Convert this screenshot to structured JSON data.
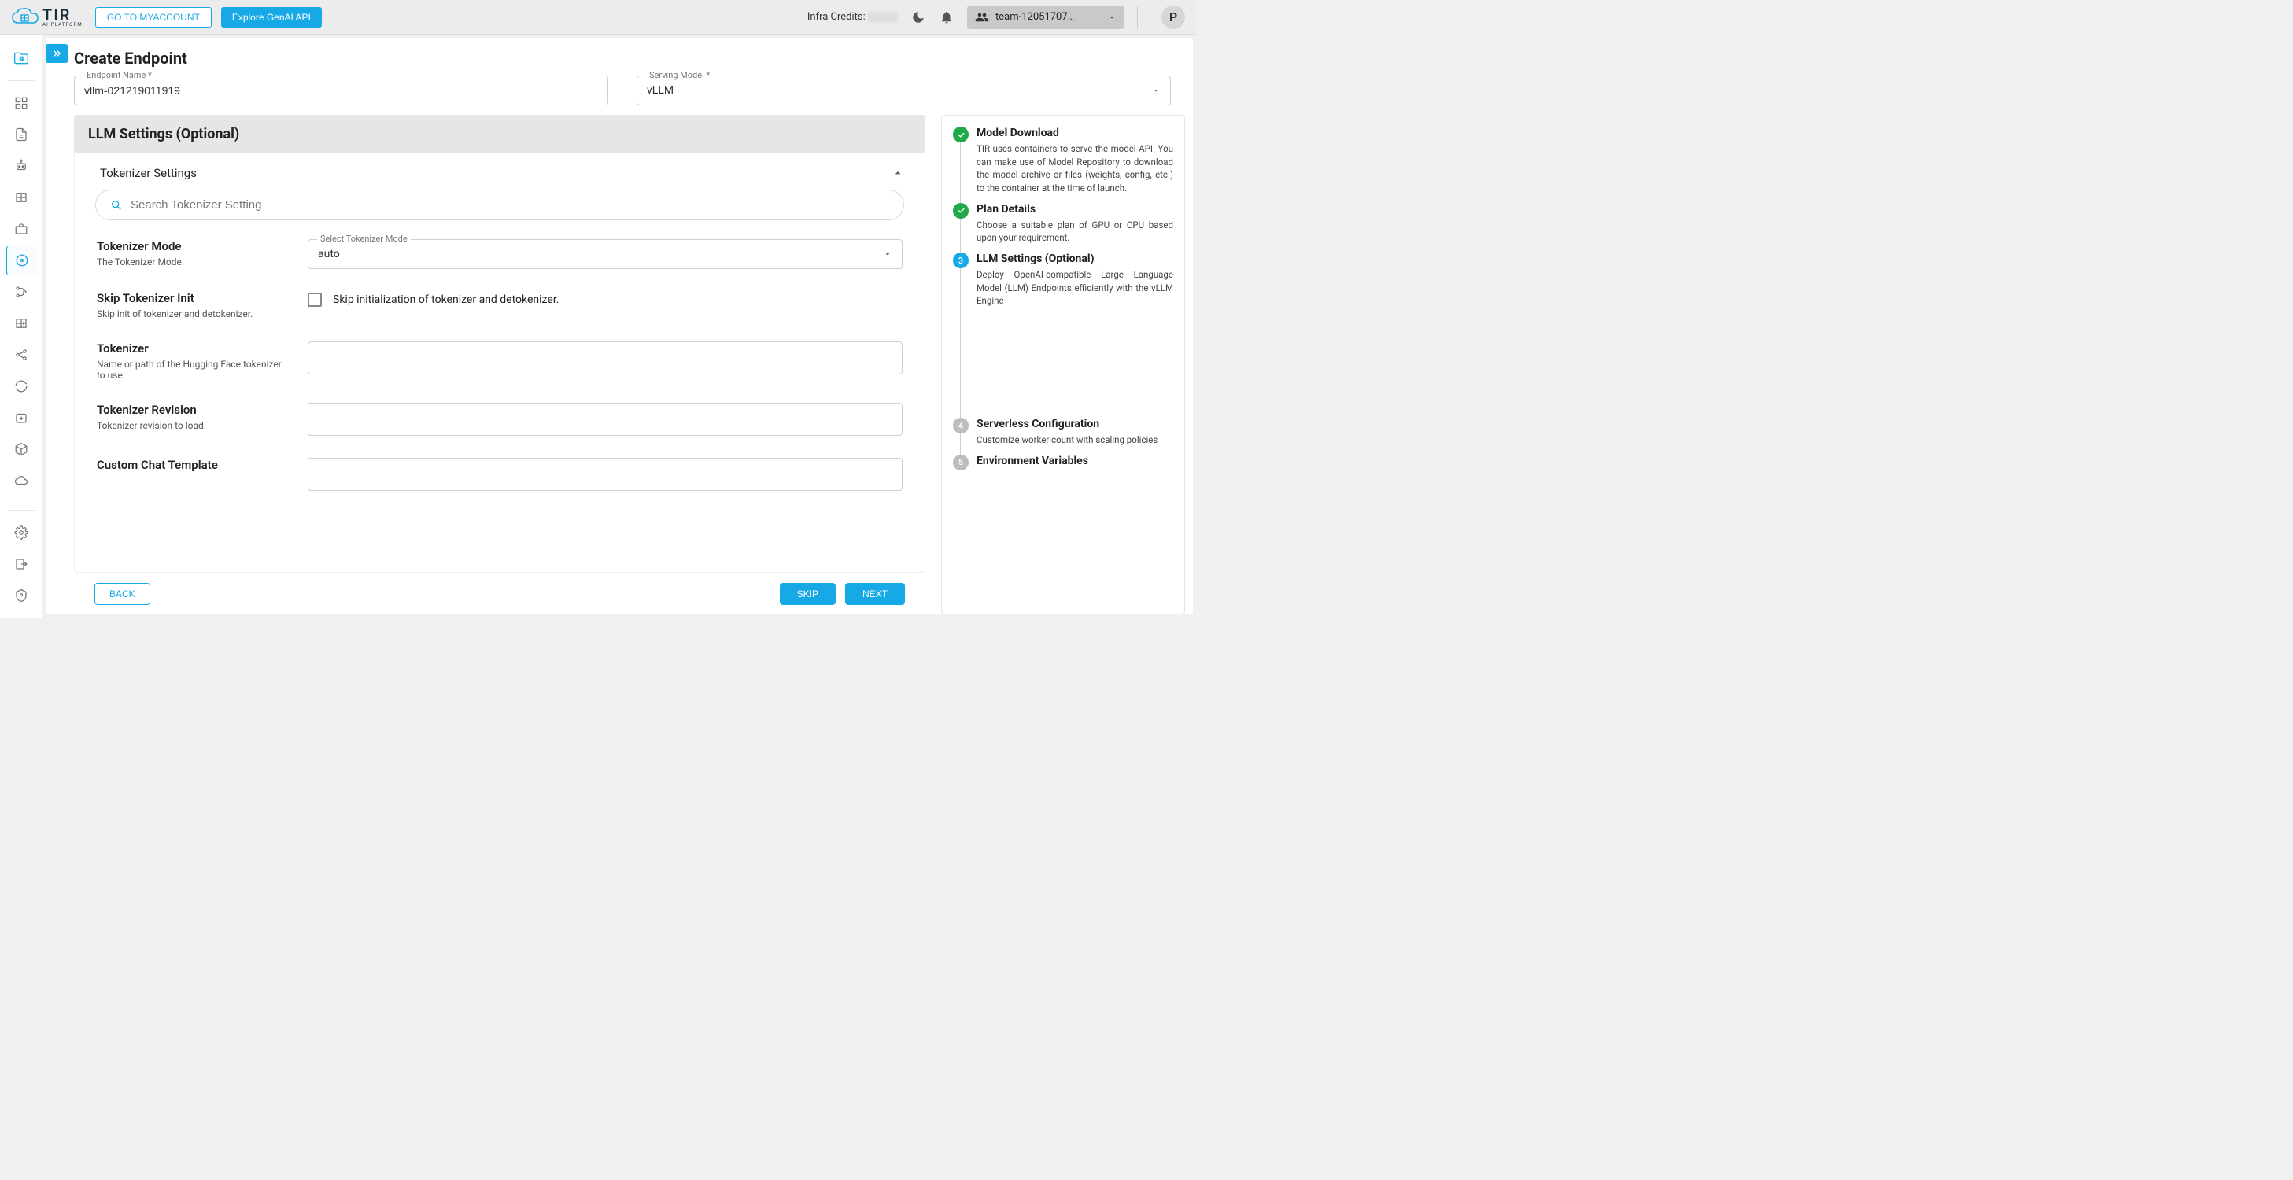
{
  "header": {
    "logo_main": "TIR",
    "logo_sub": "AI PLATFORM",
    "goto_myaccount": "GO TO MYACCOUNT",
    "explore_genai": "Explore GenAI API",
    "infra_credits_label": "Infra Credits:",
    "team_name": "team-12051707…",
    "avatar_letter": "P"
  },
  "page": {
    "title": "Create Endpoint",
    "endpoint_name_label": "Endpoint Name *",
    "endpoint_name_value": "vllm-021219011919",
    "serving_model_label": "Serving Model *",
    "serving_model_value": "vLLM"
  },
  "section": {
    "title": "LLM Settings (Optional)",
    "accordion": "Tokenizer Settings",
    "search_placeholder": "Search Tokenizer Setting"
  },
  "settings": {
    "tokenizer_mode": {
      "title": "Tokenizer Mode",
      "desc": "The Tokenizer Mode.",
      "field_label": "Select Tokenizer Mode",
      "value": "auto"
    },
    "skip_init": {
      "title": "Skip Tokenizer Init",
      "desc": "Skip init of tokenizer and detokenizer.",
      "checkbox_text": "Skip initialization of tokenizer and detokenizer."
    },
    "tokenizer": {
      "title": "Tokenizer",
      "desc": "Name or path of the Hugging Face tokenizer to use."
    },
    "tokenizer_revision": {
      "title": "Tokenizer Revision",
      "desc": "Tokenizer revision to load."
    },
    "custom_chat_template": {
      "title": "Custom Chat Template"
    }
  },
  "steps": [
    {
      "status": "done",
      "num": "✓",
      "title": "Model Download",
      "desc": "TIR uses containers to serve the model API. You can make use of Model Repository to download the model archive or files (weights, config, etc.) to the container at the time of launch."
    },
    {
      "status": "done",
      "num": "✓",
      "title": "Plan Details",
      "desc": "Choose a suitable plan of GPU or CPU based upon your requirement."
    },
    {
      "status": "current",
      "num": "3",
      "title": "LLM Settings (Optional)",
      "desc": "Deploy OpenAI-compatible Large Language Model (LLM) Endpoints efficiently with the vLLM Engine"
    },
    {
      "status": "pending",
      "num": "4",
      "title": "Serverless Configuration",
      "desc": "Customize worker count with scaling policies"
    },
    {
      "status": "pending",
      "num": "5",
      "title": "Environment Variables",
      "desc": ""
    }
  ],
  "footer": {
    "back": "BACK",
    "skip": "SKIP",
    "next": "NEXT"
  }
}
